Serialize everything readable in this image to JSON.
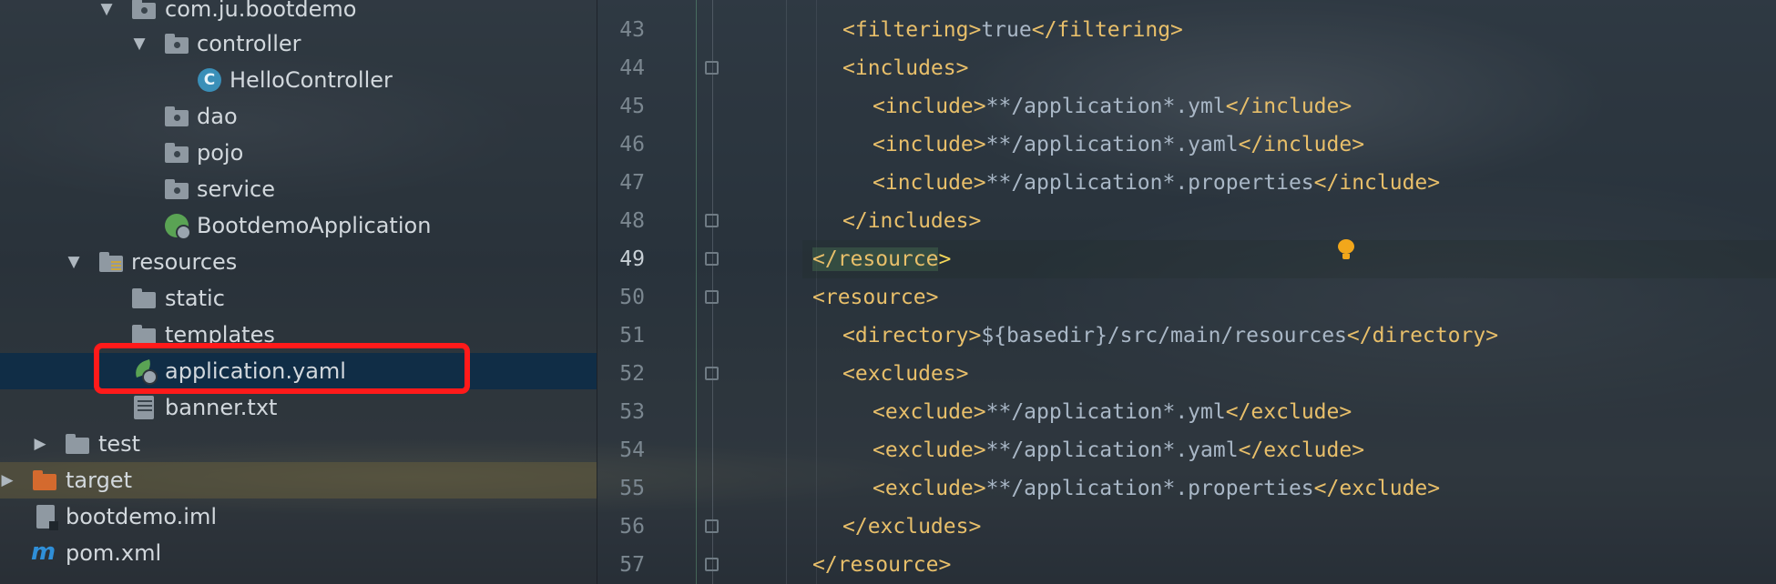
{
  "tree": {
    "items": [
      {
        "label": "com.ju.bootdemo",
        "icon": "package-folder-icon"
      },
      {
        "label": "controller",
        "icon": "package-folder-icon"
      },
      {
        "label": "HelloController",
        "icon": "class-icon",
        "icon_letter": "C"
      },
      {
        "label": "dao",
        "icon": "package-folder-icon"
      },
      {
        "label": "pojo",
        "icon": "package-folder-icon"
      },
      {
        "label": "service",
        "icon": "package-folder-icon"
      },
      {
        "label": "BootdemoApplication",
        "icon": "spring-boot-class-icon"
      },
      {
        "label": "resources",
        "icon": "resources-folder-icon"
      },
      {
        "label": "static",
        "icon": "folder-icon"
      },
      {
        "label": "templates",
        "icon": "folder-icon"
      },
      {
        "label": "application.yaml",
        "icon": "spring-config-icon"
      },
      {
        "label": "banner.txt",
        "icon": "text-file-icon"
      },
      {
        "label": "test",
        "icon": "folder-icon"
      },
      {
        "label": "target",
        "icon": "excluded-folder-icon"
      },
      {
        "label": "bootdemo.iml",
        "icon": "module-file-icon"
      },
      {
        "label": "pom.xml",
        "icon": "maven-icon",
        "icon_letter": "m"
      }
    ],
    "selected": "application.yaml",
    "highlight_color": "#ff1a1a",
    "arrows": {
      "expanded": "▼",
      "collapsed": "▶"
    }
  },
  "editor": {
    "lines": [
      {
        "num": "43",
        "parts": [
          [
            "tag",
            "<filtering>"
          ],
          [
            "txt",
            "true"
          ],
          [
            "tag",
            "</filtering>"
          ]
        ]
      },
      {
        "num": "44",
        "parts": [
          [
            "tag",
            "<includes>"
          ]
        ]
      },
      {
        "num": "45",
        "parts": [
          [
            "tag",
            "<include>"
          ],
          [
            "txt",
            "**/application*.yml"
          ],
          [
            "tag",
            "</include>"
          ]
        ]
      },
      {
        "num": "46",
        "parts": [
          [
            "tag",
            "<include>"
          ],
          [
            "txt",
            "**/application*.yaml"
          ],
          [
            "tag",
            "</include>"
          ]
        ]
      },
      {
        "num": "47",
        "parts": [
          [
            "tag",
            "<include>"
          ],
          [
            "txt",
            "**/application*.properties"
          ],
          [
            "tag",
            "</include>"
          ]
        ]
      },
      {
        "num": "48",
        "parts": [
          [
            "tag",
            "</includes>"
          ]
        ]
      },
      {
        "num": "49",
        "parts": [
          [
            "hl",
            "</resource"
          ],
          [
            "hlc",
            ">"
          ]
        ]
      },
      {
        "num": "50",
        "parts": [
          [
            "tag",
            "<resource>"
          ]
        ]
      },
      {
        "num": "51",
        "parts": [
          [
            "tag",
            "<directory>"
          ],
          [
            "txt",
            "${basedir}/src/main/resources"
          ],
          [
            "tag",
            "</directory>"
          ]
        ]
      },
      {
        "num": "52",
        "parts": [
          [
            "tag",
            "<excludes>"
          ]
        ]
      },
      {
        "num": "53",
        "parts": [
          [
            "tag",
            "<exclude>"
          ],
          [
            "txt",
            "**/application*.yml"
          ],
          [
            "tag",
            "</exclude>"
          ]
        ]
      },
      {
        "num": "54",
        "parts": [
          [
            "tag",
            "<exclude>"
          ],
          [
            "txt",
            "**/application*.yaml"
          ],
          [
            "tag",
            "</exclude>"
          ]
        ]
      },
      {
        "num": "55",
        "parts": [
          [
            "tag",
            "<exclude>"
          ],
          [
            "txt",
            "**/application*.properties"
          ],
          [
            "tag",
            "</exclude>"
          ]
        ]
      },
      {
        "num": "56",
        "parts": [
          [
            "tag",
            "</excludes>"
          ]
        ]
      },
      {
        "num": "57",
        "parts": [
          [
            "tag",
            "</resource>"
          ]
        ]
      }
    ],
    "current_line": "49",
    "colors": {
      "tag": "#e8bf6a",
      "text": "#a9b7c6",
      "bulb": "#f2a71b"
    }
  }
}
